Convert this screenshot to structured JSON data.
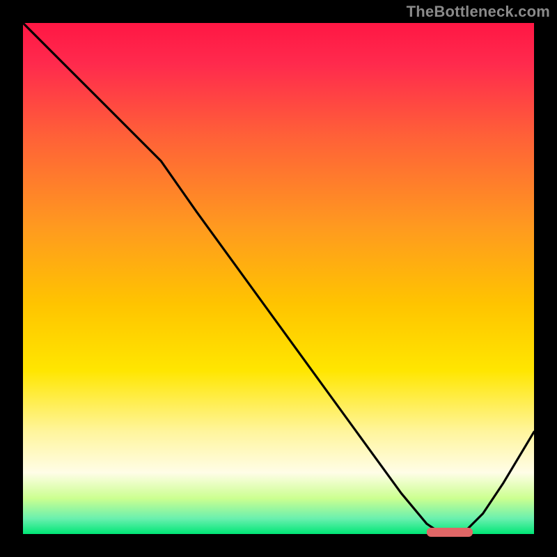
{
  "watermark": "TheBottleneck.com",
  "chart_data": {
    "type": "line",
    "title": "",
    "xlabel": "",
    "ylabel": "",
    "xlim": [
      0,
      100
    ],
    "ylim": [
      0,
      100
    ],
    "x": [
      0,
      8,
      16,
      24,
      27,
      34,
      42,
      50,
      58,
      66,
      74,
      79,
      82,
      86,
      90,
      94,
      100
    ],
    "y": [
      100,
      92,
      84,
      76,
      73,
      63,
      52,
      41,
      30,
      19,
      8,
      2,
      0,
      0,
      4,
      10,
      20
    ],
    "min_segment_x": [
      79,
      88
    ],
    "colors": {
      "curve": "#000000",
      "marker": "#e06666",
      "gradient_top": "#ff1744",
      "gradient_bottom": "#00e676"
    }
  }
}
